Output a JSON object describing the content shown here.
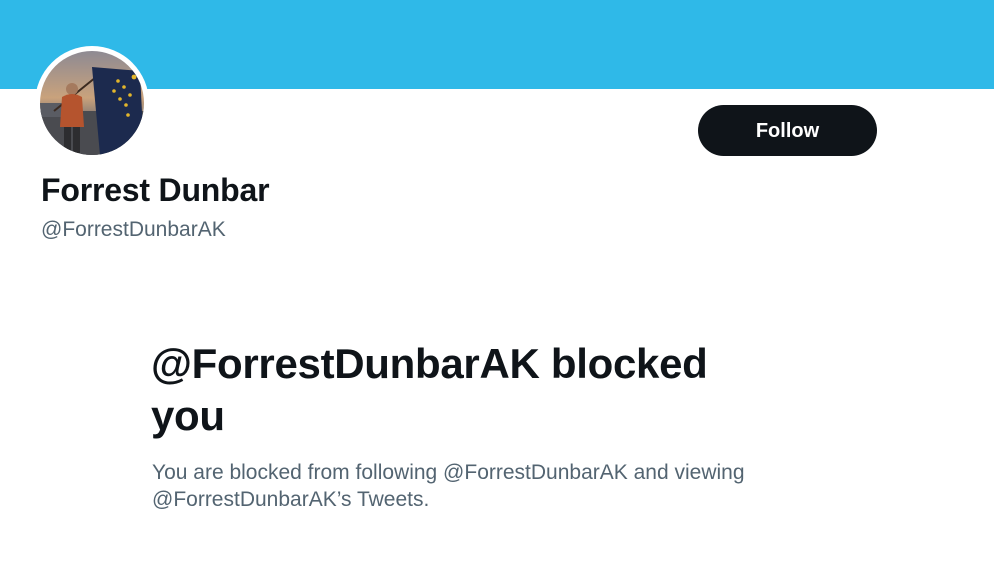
{
  "colors": {
    "banner": "#2fb9e8",
    "follow_button_bg": "#0f1419",
    "text_primary": "#0f1419",
    "text_secondary": "#536471"
  },
  "profile": {
    "display_name": "Forrest Dunbar",
    "handle": "@ForrestDunbarAK",
    "avatar_icon": "profile-photo-with-alaska-flag"
  },
  "actions": {
    "follow_label": "Follow"
  },
  "blocked_notice": {
    "title": "@ForrestDunbarAK blocked you",
    "description": "You are blocked from following @ForrestDunbarAK and viewing @ForrestDunbarAK’s Tweets."
  }
}
